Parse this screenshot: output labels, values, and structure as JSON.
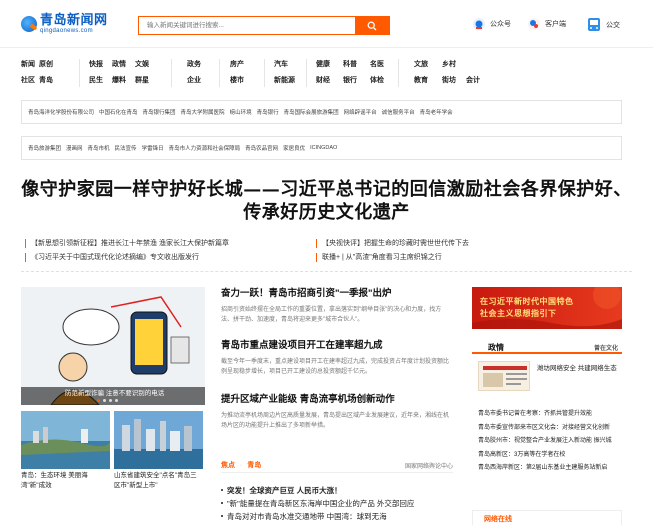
{
  "header": {
    "logo_cn": "青岛新闻网",
    "logo_en": "qingdaonews.com",
    "search_placeholder": "输入新闻关键词进行搜索...",
    "links": [
      "公众号",
      "客户端",
      "公交"
    ]
  },
  "nav": {
    "columns": [
      [
        "新闻",
        "原创",
        "社区",
        "青岛"
      ],
      [
        "快报",
        "政情",
        "文娱",
        "民生",
        "爆料",
        "群星"
      ],
      [
        "政务",
        "企业"
      ],
      [
        "房产",
        "楼市"
      ],
      [
        "汽车",
        "新能源"
      ],
      [
        "健康",
        "科普",
        "名医",
        "财经",
        "银行",
        "体检"
      ],
      [
        "文旅",
        "乡村",
        "教育",
        "街坊",
        "会计"
      ]
    ]
  },
  "linkbox1": [
    "青岛海洋化学股份有限公司",
    "中国石化在青岛",
    "青岛银行集团",
    "青岛大学附属医院",
    "崂山环境",
    "青岛银行",
    "青岛国际会展旅游集团",
    "网络辟谣平台",
    "诚信服务平台",
    "青岛老年学会"
  ],
  "linkbox2": [
    "青岛旅游集团",
    "漫画网",
    "青岛市机",
    "民法宣传",
    "学雷锋日",
    "青岛市人力资源和社会保障局",
    "青岛农品官网",
    "家居良优",
    "ICINGDAO"
  ],
  "headline": "像守护家园一样守护好长城——习近平总书记的回信激励社会各界保护好、传承好历史文化遗产",
  "sub_news_left": [
    "【新思想引领新征程】推进长江十年禁渔 渔家长江大保护新篇章",
    "《习近平关于中国式现代化论述摘编》专文收出版发行"
  ],
  "sub_news_right": [
    "【央视快评】把握生命的珍藏时需世世代传下去",
    "联播+ | 从\"高渣\"角度看习主席织锦之行"
  ],
  "slide": {
    "caption": "防范新型诈骗 注意不要识别的电话",
    "dot_active": 0,
    "dot_count": 4
  },
  "thumbs": [
    "青岛：生态环境 美丽海湾\"新\"成效",
    "山东省建筑安全\"点名\"青岛三区市\"新型上市\""
  ],
  "stories": [
    {
      "title": "奋力一跃！青岛市招商引资\"一季报\"出炉",
      "desc": "招商引资始终摆在全局工作的重要位置，拿出落实到\"纲举目张\"的决心和力度，找方法、拼干劲、加速度，青岛将迎来更多\"城市合伙人\"。"
    },
    {
      "title": "青岛市重点建设项目开工在建率超九成",
      "desc": "截至今年一季度末，重点建设项目开工在建率超过九成，完成投资占年度计划投资额比例呈现稳步增长，项目已开工建设的总投资额超千亿元。"
    },
    {
      "title": "提升区域产业能级 青岛流亭机场创新动作",
      "desc": "为推动流亭机场周边片区高质量发展，青岛提出区域产业发展建议，近年来，湘线在机场片区的功能提升上推出了多项新举措。"
    }
  ],
  "focus": {
    "tab1": "焦点",
    "tab2": "青岛",
    "right_label": "国家网络舆论中心",
    "items": [
      "突发！全球资产巨豆 人民币大涨！",
      "\"新\"能量提在青岛新区东海岸中国企业的产品 外交部回应",
      "青岛对对市青岛水准交通地带 中国湾：球到无海"
    ]
  },
  "right": {
    "banner_line1": "在习近平新时代中国特色",
    "banner_line2": "社会主义思想指引下",
    "zb_title": "政情",
    "zb_more": "曾在文化",
    "zb_text": "潍坊网络安全 共建网络生态",
    "list": [
      "青岛市委书记曾在考察：齐抓共管提升效能",
      "青岛市委宣传部来市区文化会：对接经营文化创新",
      "青岛胶州市：视觉整合产业发展注入新动能 振兴城",
      "青岛高新区：3万高等在学者在校",
      "青岛西海岸新区：第2届山东基业主建服务站新启"
    ],
    "online_title": "网络在线"
  }
}
